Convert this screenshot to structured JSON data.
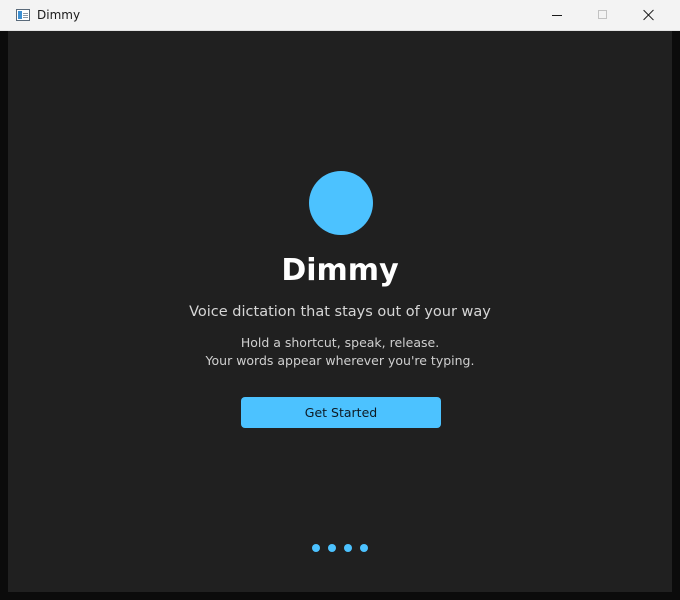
{
  "window": {
    "title": "Dimmy",
    "icon": "app-window-icon",
    "controls": [
      "minimize-icon",
      "maximize-icon",
      "close-icon"
    ]
  },
  "welcome": {
    "logo": "logo-circle",
    "app_name": "Dimmy",
    "tagline": "Voice dictation that stays out of your way",
    "description_line1": "Hold a shortcut, speak, release.",
    "description_line2": "Your words appear wherever you're typing.",
    "button_label": "Get Started"
  },
  "pager": {
    "page_count": 4
  },
  "colors": {
    "accent": "#4cc2ff",
    "background": "#202020",
    "titlebar": "#f3f3f3",
    "text_primary": "#ffffff",
    "text_secondary": "#d6d6d6"
  }
}
